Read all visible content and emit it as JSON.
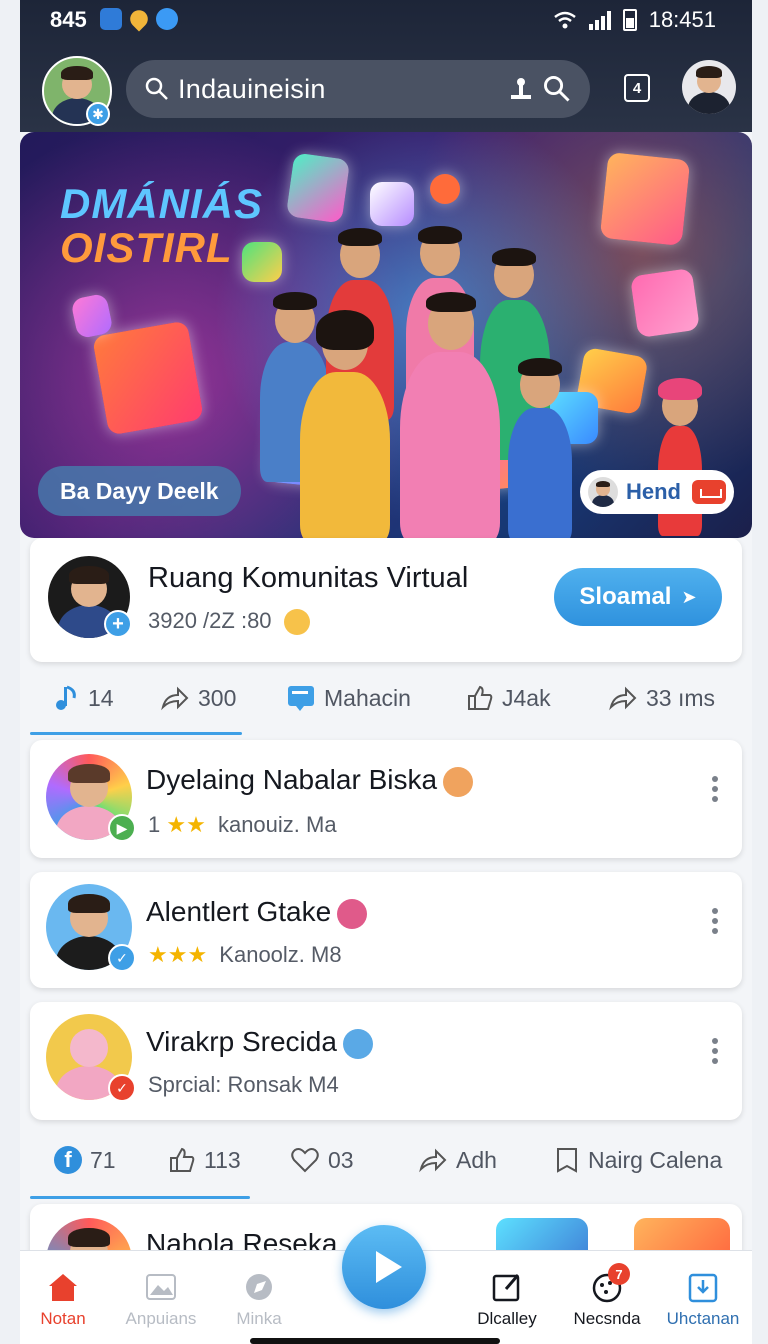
{
  "status_bar": {
    "time_left": "845",
    "time_right": "18:451"
  },
  "header": {
    "search_text": "Indauineisin",
    "square_button_label": "4"
  },
  "hero": {
    "title_line1": "DMÁNIÁS",
    "title_line2": "OISTIRL",
    "left_pill": "Ba Dayy Deelk",
    "right_pill": "Hend"
  },
  "profile_card": {
    "name": "Ruang Komunitas Virtual",
    "meta": "3920 /2Z :80",
    "follow_label": "Sloamal"
  },
  "actions_row1": [
    {
      "icon": "music-note-icon",
      "label": "14"
    },
    {
      "icon": "share-arrow-icon",
      "label": "300"
    },
    {
      "icon": "message-icon",
      "label": "Mahacin"
    },
    {
      "icon": "thumbs-up-icon",
      "label": "J4ak"
    },
    {
      "icon": "share-arrow-icon",
      "label": "33 ıms"
    }
  ],
  "list_items": [
    {
      "name": "Dyelaing Nabalar Biska",
      "sub_prefix": "1",
      "stars": "★★",
      "sub": "kanouiz. Ma",
      "emoji_color": "#f0a35e"
    },
    {
      "name": "Alentlert Gtake",
      "sub_prefix": "",
      "stars": "★★★",
      "sub": "Kanoolz. M8",
      "emoji_color": "#e05a8a"
    },
    {
      "name": "Virakrp Srecida",
      "sub_prefix": "",
      "stars": "",
      "sub": "Sprcial: Ronsak  M4",
      "emoji_color": "#5aa9e6"
    }
  ],
  "actions_row2": [
    {
      "icon": "facebook-icon",
      "label": "71"
    },
    {
      "icon": "thumbs-up-icon",
      "label": "113"
    },
    {
      "icon": "heart-icon",
      "label": "03"
    },
    {
      "icon": "share-arrow-icon",
      "label": "Adh"
    },
    {
      "icon": "bookmark-icon",
      "label": "Nairg Calena"
    }
  ],
  "partial_item": {
    "name": "Nahola Reseka"
  },
  "bottom_nav": [
    {
      "label": "Notan",
      "icon": "home-icon",
      "active": true
    },
    {
      "label": "Anpuians",
      "icon": "image-icon",
      "active": false
    },
    {
      "label": "Minka",
      "icon": "explore-icon",
      "active": false
    },
    {
      "label": "Dlcalley",
      "icon": "edit-icon",
      "active": false
    },
    {
      "label": "Necsnda",
      "icon": "notifications-icon",
      "badge": "7",
      "active": false
    },
    {
      "label": "Uhctanan",
      "icon": "download-icon",
      "active": false
    }
  ],
  "colors": {
    "accent": "#3e9fe6",
    "active_nav": "#e8412d",
    "header_bg": "#1d2538"
  }
}
